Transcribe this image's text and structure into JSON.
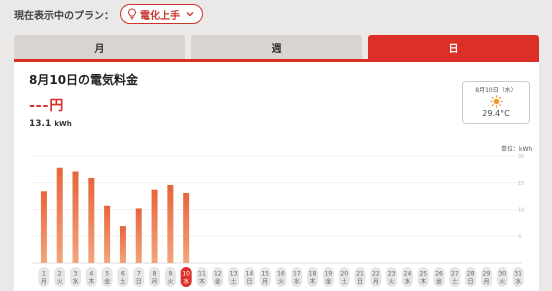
{
  "plan": {
    "label": "現在表示中のプラン：",
    "name": "電化上手"
  },
  "tabs": [
    {
      "label": "月",
      "active": false
    },
    {
      "label": "週",
      "active": false
    },
    {
      "label": "日",
      "active": true
    }
  ],
  "summary": {
    "title": "8月10日の電気料金",
    "price": "---円",
    "usage_value": "13.1",
    "usage_unit": "kWh"
  },
  "weather": {
    "date": "8月10日（水）",
    "icon": "sun-icon",
    "temperature": "29.4°C"
  },
  "colors": {
    "accent": "#dc2f28",
    "bar": "#e8653b",
    "bar_light": "#f3a47c"
  },
  "chart_data": {
    "type": "bar",
    "unit_label": "単位：kWh",
    "y_ticks": [
      "20",
      "15",
      "10",
      "5"
    ],
    "ylim": [
      0,
      20
    ],
    "grid": true,
    "selected_day": "10",
    "categories": [
      "1",
      "2",
      "3",
      "4",
      "5",
      "6",
      "7",
      "8",
      "9",
      "10",
      "11",
      "12",
      "13",
      "14",
      "15",
      "16",
      "17",
      "18",
      "19",
      "20",
      "21",
      "22",
      "23",
      "24",
      "25",
      "26",
      "27",
      "28",
      "29",
      "30",
      "31"
    ],
    "weekdays": [
      "月",
      "火",
      "水",
      "木",
      "金",
      "土",
      "日",
      "月",
      "火",
      "水",
      "木",
      "金",
      "土",
      "日",
      "月",
      "火",
      "水",
      "木",
      "金",
      "土",
      "日",
      "月",
      "火",
      "水",
      "木",
      "金",
      "土",
      "日",
      "月",
      "火",
      "水"
    ],
    "values": [
      13.4,
      17.8,
      17.1,
      15.9,
      10.7,
      6.9,
      10.2,
      13.7,
      14.6,
      13.1,
      null,
      null,
      null,
      null,
      null,
      null,
      null,
      null,
      null,
      null,
      null,
      null,
      null,
      null,
      null,
      null,
      null,
      null,
      null,
      null,
      null
    ]
  }
}
